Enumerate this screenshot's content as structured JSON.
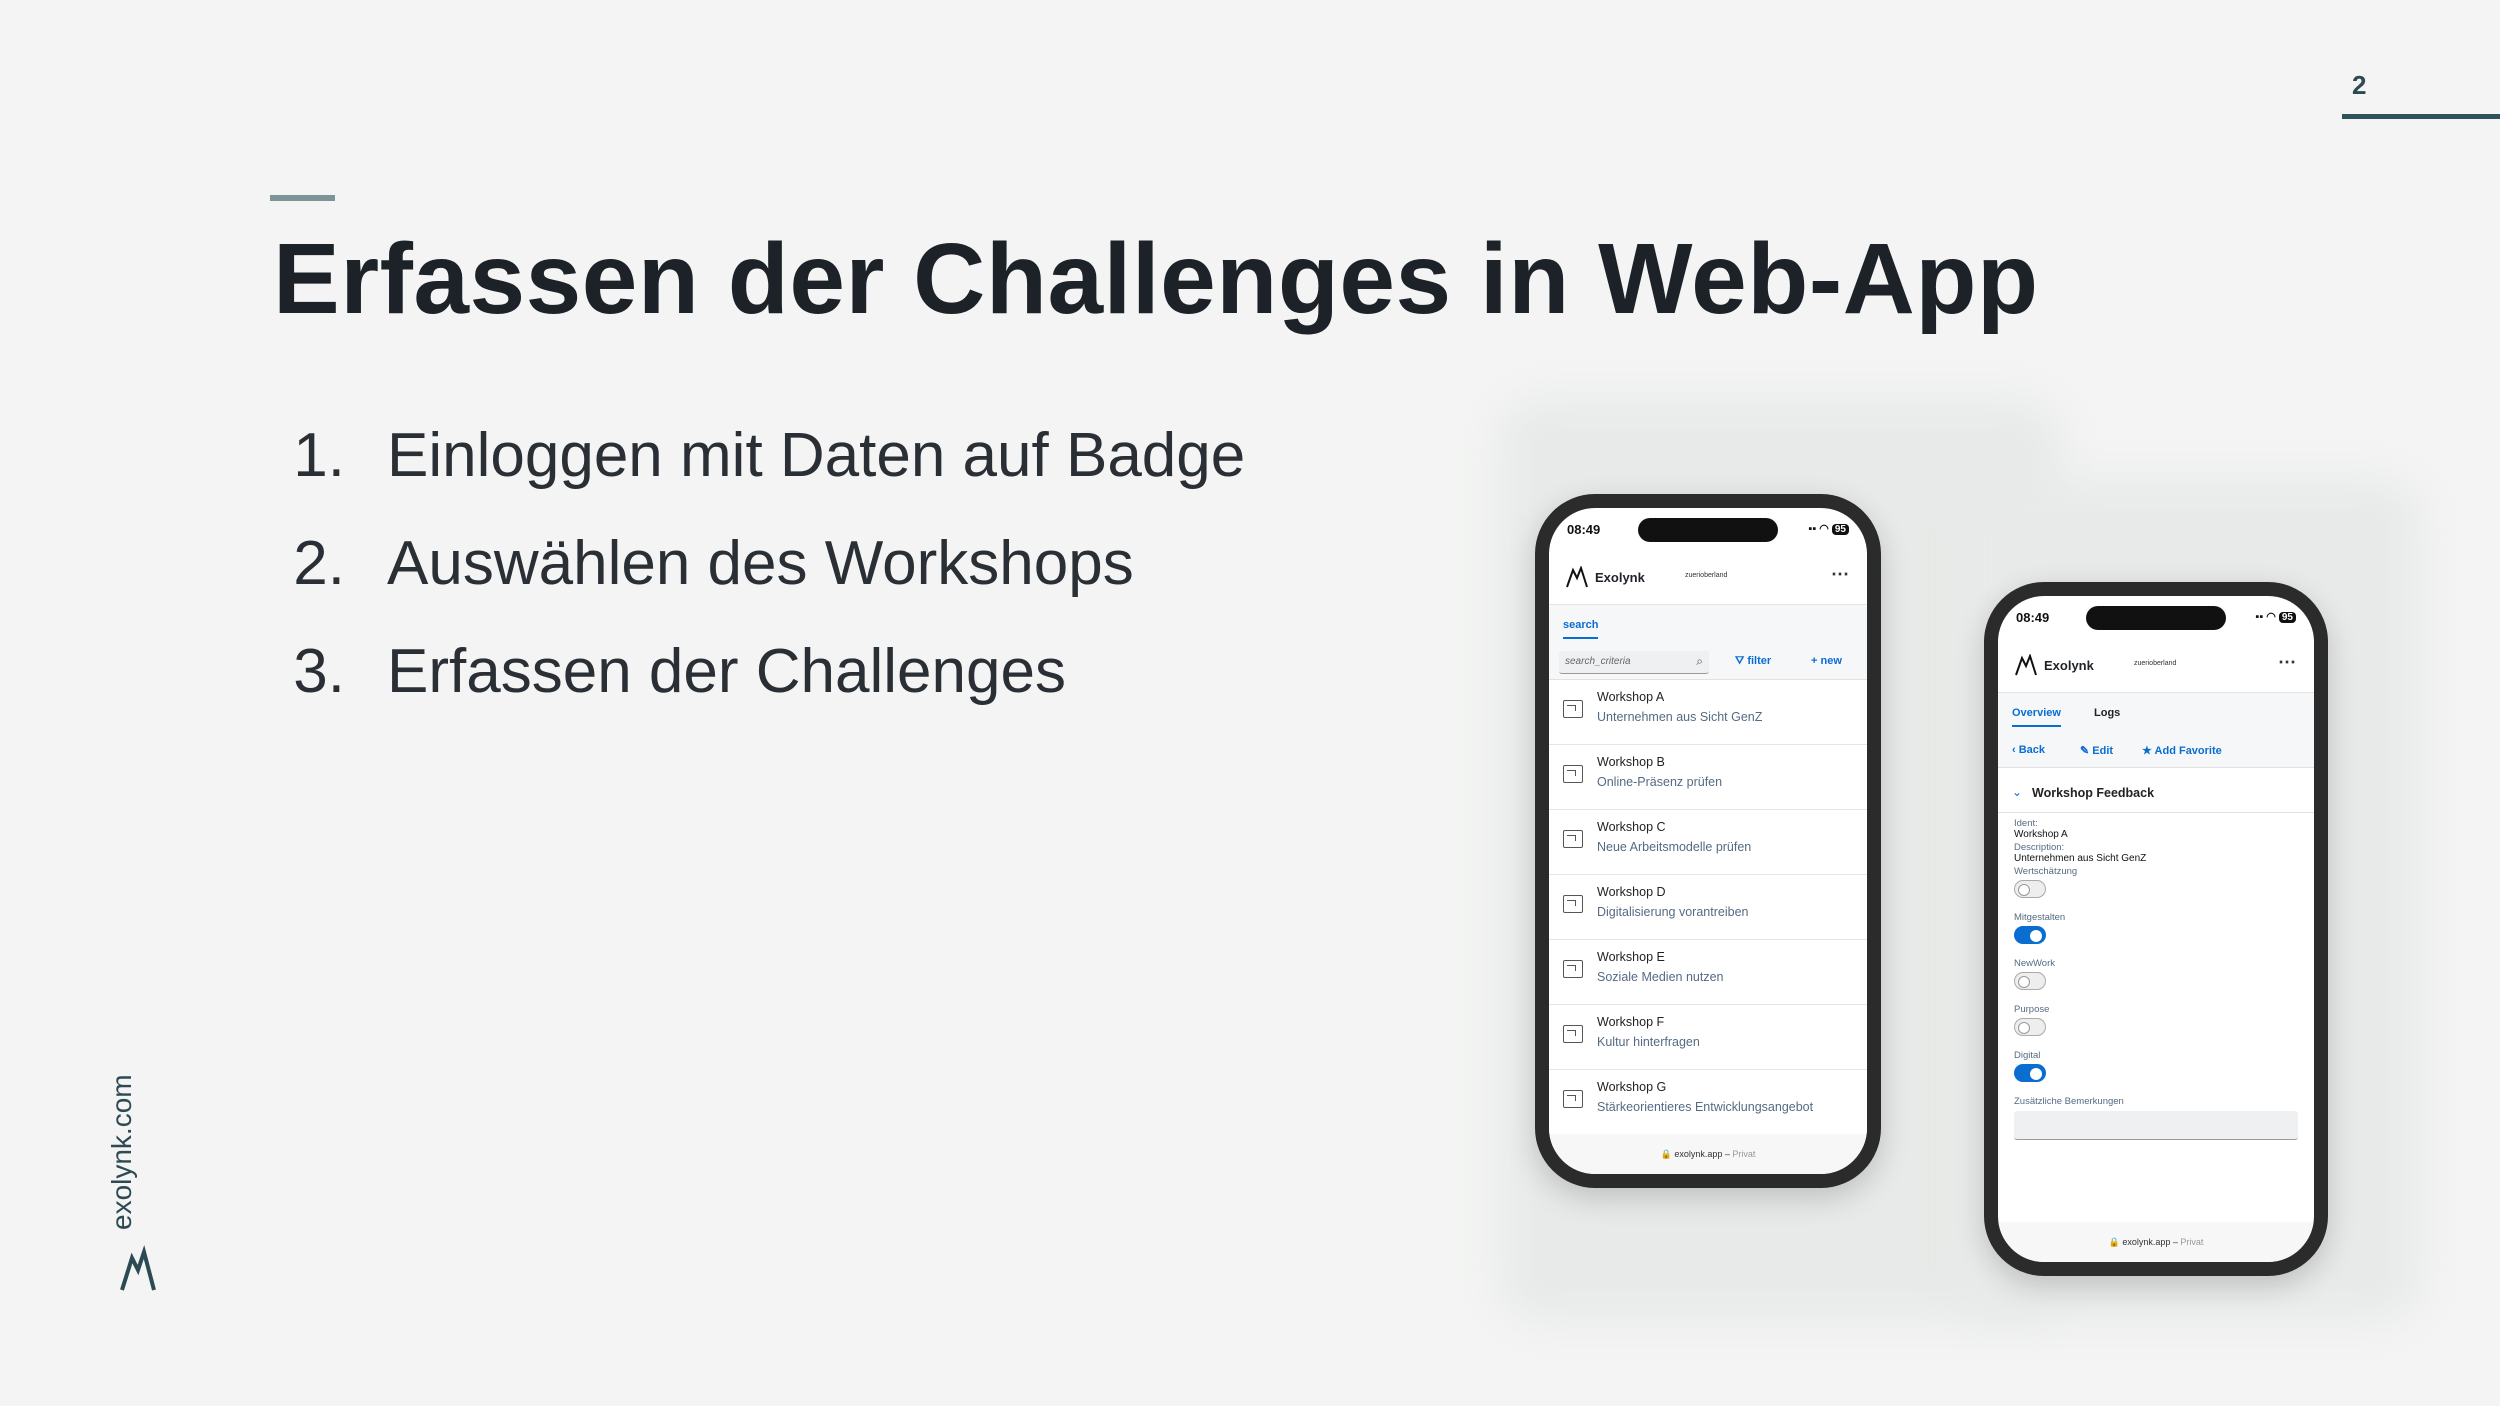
{
  "slide": {
    "page_number": "2",
    "title": "Erfassen der Challenges in Web-App",
    "steps": [
      {
        "num": "1.",
        "text": "Einloggen mit Daten auf Badge"
      },
      {
        "num": "2.",
        "text": "Auswählen des Workshops"
      },
      {
        "num": "3.",
        "text": "Erfassen der Challenges"
      }
    ],
    "brand": "exolynk.com",
    "brand_color": "#2c4a52"
  },
  "phone_list": {
    "status": {
      "time": "08:49",
      "battery": "95"
    },
    "app_name": "Exolynk",
    "org": "zuerioberland",
    "tab_active": "search",
    "search_placeholder": "search_criteria",
    "filter_label": "filter",
    "new_label": "new",
    "items": [
      {
        "title": "Workshop A",
        "subtitle": "Unternehmen aus Sicht GenZ"
      },
      {
        "title": "Workshop B",
        "subtitle": "Online-Präsenz prüfen"
      },
      {
        "title": "Workshop C",
        "subtitle": "Neue Arbeitsmodelle prüfen"
      },
      {
        "title": "Workshop D",
        "subtitle": "Digitalisierung vorantreiben"
      },
      {
        "title": "Workshop E",
        "subtitle": "Soziale Medien nutzen"
      },
      {
        "title": "Workshop F",
        "subtitle": "Kultur hinterfragen"
      },
      {
        "title": "Workshop G",
        "subtitle": "Stärkeorientieres Entwicklungsangebot"
      }
    ],
    "footer_url": "exolynk.app",
    "footer_private": "Privat"
  },
  "phone_detail": {
    "status": {
      "time": "08:49",
      "battery": "95"
    },
    "app_name": "Exolynk",
    "org": "zuerioberland",
    "tabs": [
      "Overview",
      "Logs"
    ],
    "back_label": "Back",
    "edit_label": "Edit",
    "favorite_label": "Add Favorite",
    "section_title": "Workshop Feedback",
    "ident_label": "Ident:",
    "ident_value": "Workshop A",
    "description_label": "Description:",
    "description_value": "Unternehmen aus Sicht GenZ",
    "toggles": [
      {
        "label": "Wertschätzung",
        "on": false
      },
      {
        "label": "Mitgestalten",
        "on": true
      },
      {
        "label": "NewWork",
        "on": false
      },
      {
        "label": "Purpose",
        "on": false
      },
      {
        "label": "Digital",
        "on": true
      }
    ],
    "remarks_label": "Zusätzliche Bemerkungen",
    "footer_url": "exolynk.app",
    "footer_private": "Privat"
  },
  "colors": {
    "background": "#f3f4f3",
    "accent_blue": "#0a6ed1",
    "title_dark": "#1c2228",
    "teal": "#2f535b"
  }
}
